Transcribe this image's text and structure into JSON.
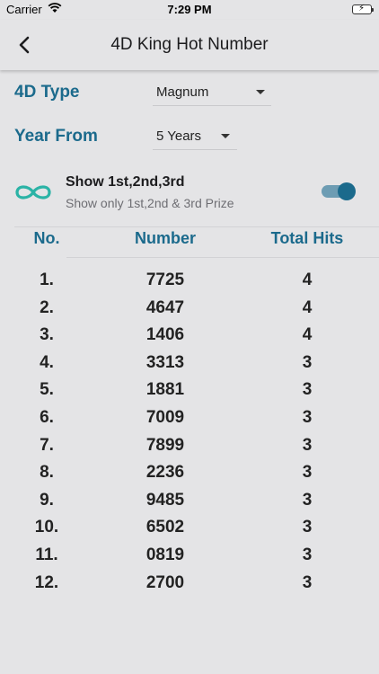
{
  "status_bar": {
    "carrier": "Carrier",
    "time": "7:29 PM"
  },
  "header": {
    "title": "4D King Hot Number"
  },
  "filters": {
    "type_label": "4D Type",
    "type_value": "Magnum",
    "year_label": "Year From",
    "year_value": "5 Years"
  },
  "prize_option": {
    "title": "Show 1st,2nd,3rd",
    "subtitle": "Show only 1st,2nd & 3rd Prize",
    "enabled": true
  },
  "table": {
    "headers": {
      "no": "No.",
      "number": "Number",
      "hits": "Total Hits"
    },
    "rows": [
      {
        "no": "1.",
        "number": "7725",
        "hits": "4"
      },
      {
        "no": "2.",
        "number": "4647",
        "hits": "4"
      },
      {
        "no": "3.",
        "number": "1406",
        "hits": "4"
      },
      {
        "no": "4.",
        "number": "3313",
        "hits": "3"
      },
      {
        "no": "5.",
        "number": "1881",
        "hits": "3"
      },
      {
        "no": "6.",
        "number": "7009",
        "hits": "3"
      },
      {
        "no": "7.",
        "number": "7899",
        "hits": "3"
      },
      {
        "no": "8.",
        "number": "2236",
        "hits": "3"
      },
      {
        "no": "9.",
        "number": "9485",
        "hits": "3"
      },
      {
        "no": "10.",
        "number": "6502",
        "hits": "3"
      },
      {
        "no": "11.",
        "number": "0819",
        "hits": "3"
      },
      {
        "no": "12.",
        "number": "2700",
        "hits": "3"
      }
    ]
  },
  "colors": {
    "accent": "#1b6a8c",
    "teal": "#2bb3a6",
    "background": "#e4e4e6"
  }
}
